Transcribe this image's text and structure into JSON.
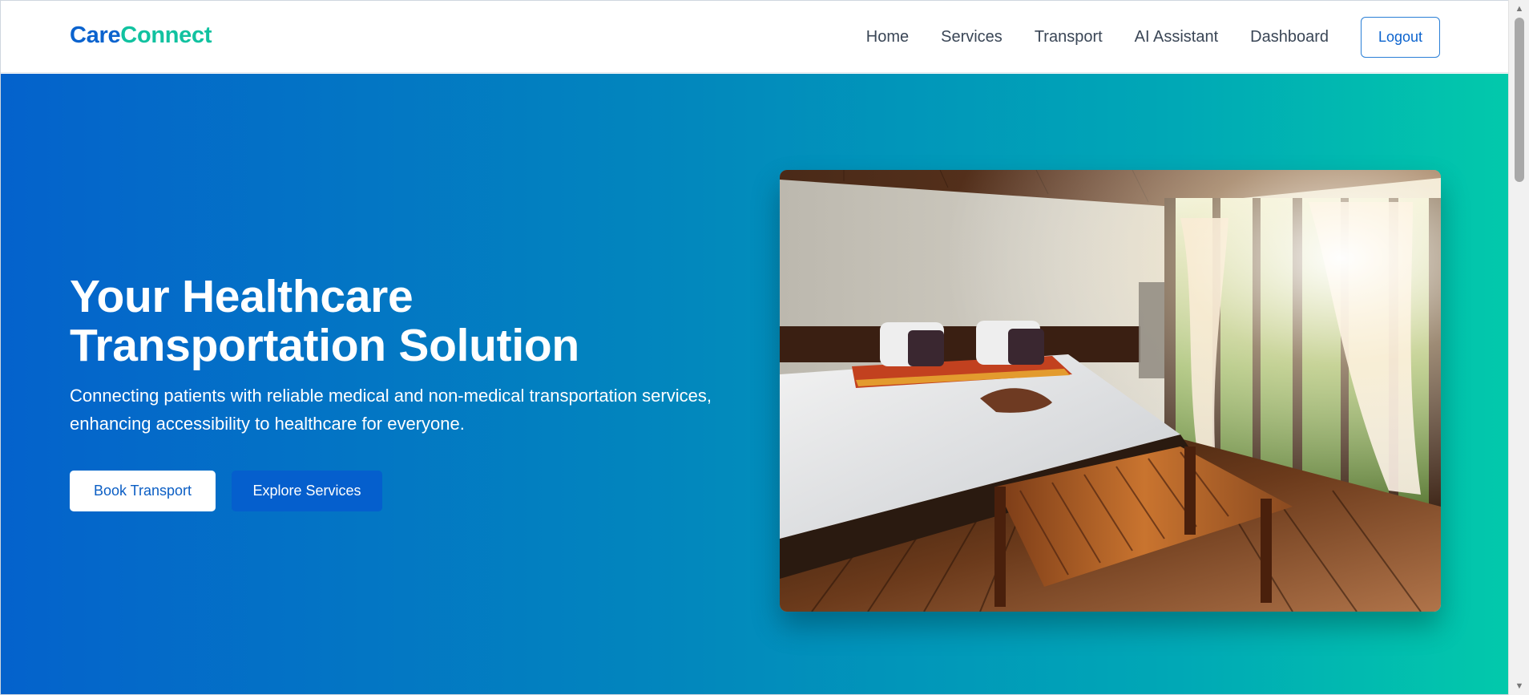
{
  "brand": {
    "part1": "Care",
    "part2": "Connect",
    "colors": {
      "primary": "#0b63ce",
      "accent": "#11c2a0"
    }
  },
  "nav": {
    "items": [
      {
        "label": "Home"
      },
      {
        "label": "Services"
      },
      {
        "label": "Transport"
      },
      {
        "label": "AI Assistant"
      },
      {
        "label": "Dashboard"
      }
    ],
    "logout_label": "Logout"
  },
  "hero": {
    "title_line1": "Your Healthcare",
    "title_line2": "Transportation Solution",
    "subtitle_line1": "Connecting patients with reliable medical and non-medical transportation services,",
    "subtitle_line2": "enhancing accessibility to healthcare for everyone.",
    "primary_button": "Book Transport",
    "secondary_button": "Explore Services",
    "gradient": {
      "start": "#0462cc",
      "end": "#02c9ab"
    }
  },
  "scrollbar": {
    "up_icon": "triangle-up-icon",
    "down_icon": "triangle-down-icon"
  }
}
